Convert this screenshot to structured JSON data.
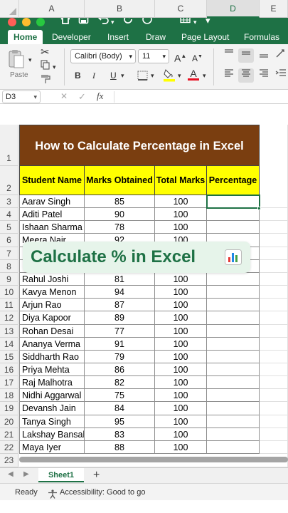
{
  "window": {
    "traffic_colors": [
      "#ff5f57",
      "#febc2e",
      "#28c840"
    ]
  },
  "ribbon_tabs": [
    "Home",
    "Developer",
    "Insert",
    "Draw",
    "Page Layout",
    "Formulas"
  ],
  "ribbon": {
    "paste_label": "Paste",
    "font_name": "Calibri (Body)",
    "font_size": "11",
    "bold": "B",
    "italic": "I",
    "underline": "U",
    "grow_font": "A",
    "shrink_font": "A",
    "font_color_letter": "A",
    "highlight_color": "#ffff00",
    "font_color": "#e81123"
  },
  "formula_bar": {
    "name_box": "D3",
    "fx": "fx",
    "cancel": "✕",
    "enter": "✓"
  },
  "columns": [
    "A",
    "B",
    "C",
    "D",
    "E"
  ],
  "sheet": {
    "title": "How to Calculate Percentage in Excel",
    "headers": [
      "Student Name",
      "Marks Obtained",
      "Total Marks",
      "Percentage"
    ],
    "rows": [
      {
        "n": "3",
        "name": "Aarav Singh",
        "marks": "85",
        "total": "100"
      },
      {
        "n": "4",
        "name": "Aditi Patel",
        "marks": "90",
        "total": "100"
      },
      {
        "n": "5",
        "name": "Ishaan Sharma",
        "marks": "78",
        "total": "100"
      },
      {
        "n": "6",
        "name": "Meera Nair",
        "marks": "92",
        "total": "100"
      },
      {
        "n": "7",
        "name": "",
        "marks": "",
        "total": ""
      },
      {
        "n": "8",
        "name": "",
        "marks": "",
        "total": ""
      },
      {
        "n": "9",
        "name": "Rahul Joshi",
        "marks": "81",
        "total": "100"
      },
      {
        "n": "10",
        "name": "Kavya Menon",
        "marks": "94",
        "total": "100"
      },
      {
        "n": "11",
        "name": "Arjun Rao",
        "marks": "87",
        "total": "100"
      },
      {
        "n": "12",
        "name": "Diya Kapoor",
        "marks": "89",
        "total": "100"
      },
      {
        "n": "13",
        "name": "Rohan Desai",
        "marks": "77",
        "total": "100"
      },
      {
        "n": "14",
        "name": "Ananya Verma",
        "marks": "91",
        "total": "100"
      },
      {
        "n": "15",
        "name": "Siddharth Rao",
        "marks": "79",
        "total": "100"
      },
      {
        "n": "16",
        "name": "Priya Mehta",
        "marks": "86",
        "total": "100"
      },
      {
        "n": "17",
        "name": "Raj Malhotra",
        "marks": "82",
        "total": "100"
      },
      {
        "n": "18",
        "name": "Nidhi Aggarwal",
        "marks": "75",
        "total": "100"
      },
      {
        "n": "19",
        "name": "Devansh Jain",
        "marks": "84",
        "total": "100"
      },
      {
        "n": "20",
        "name": "Tanya Singh",
        "marks": "95",
        "total": "100"
      },
      {
        "n": "21",
        "name": "Lakshay Bansal",
        "marks": "83",
        "total": "100"
      },
      {
        "n": "22",
        "name": "Maya Iyer",
        "marks": "88",
        "total": "100"
      }
    ],
    "row_labels": [
      "1",
      "2",
      "23"
    ],
    "title_color": "#7a3e10",
    "header_color": "#ffff00"
  },
  "overlay": {
    "text": "Calculate % in Excel"
  },
  "sheet_tabs": {
    "active": "Sheet1",
    "add": "+"
  },
  "status": {
    "ready": "Ready",
    "accessibility": "Accessibility: Good to go"
  }
}
